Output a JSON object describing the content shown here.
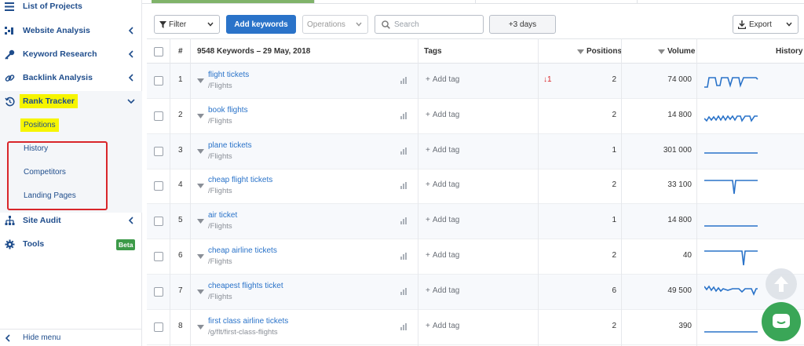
{
  "sidebar": {
    "items": [
      {
        "label": "List of Projects",
        "icon": "list-icon"
      },
      {
        "label": "Website Analysis",
        "icon": "analysis-icon"
      },
      {
        "label": "Keyword Research",
        "icon": "key-icon"
      },
      {
        "label": "Backlink Analysis",
        "icon": "link-icon"
      },
      {
        "label": "Rank Tracker",
        "icon": "history-icon"
      },
      {
        "label": "Site Audit",
        "icon": "sitemap-icon"
      },
      {
        "label": "Tools",
        "icon": "gear-icon"
      }
    ],
    "rank_tracker_sub": [
      "Positions",
      "History",
      "Competitors",
      "Landing Pages"
    ],
    "tools_badge": "Beta",
    "hide_menu": "Hide menu"
  },
  "toolbar": {
    "filter": "Filter",
    "add_keywords": "Add keywords",
    "operations": "Operations",
    "search_placeholder": "Search",
    "days": "+3 days",
    "export": "Export"
  },
  "table": {
    "headers": {
      "index": "#",
      "keywords": "9548 Keywords – 29 May, 2018",
      "tags": "Tags",
      "positions": "Positions",
      "volume": "Volume",
      "history": "History"
    },
    "add_tag": "Add tag",
    "rows": [
      {
        "n": "1",
        "kw": "flight tickets",
        "url": "/Flights",
        "delta": "1",
        "pos": "2",
        "vol": "74 000"
      },
      {
        "n": "2",
        "kw": "book flights",
        "url": "/Flights",
        "delta": "",
        "pos": "2",
        "vol": "14 800"
      },
      {
        "n": "3",
        "kw": "plane tickets",
        "url": "/Flights",
        "delta": "",
        "pos": "1",
        "vol": "301 000"
      },
      {
        "n": "4",
        "kw": "cheap flight tickets",
        "url": "/Flights",
        "delta": "",
        "pos": "2",
        "vol": "33 100"
      },
      {
        "n": "5",
        "kw": "air ticket",
        "url": "/Flights",
        "delta": "",
        "pos": "1",
        "vol": "14 800"
      },
      {
        "n": "6",
        "kw": "cheap airline tickets",
        "url": "/Flights",
        "delta": "",
        "pos": "2",
        "vol": "40"
      },
      {
        "n": "7",
        "kw": "cheapest flights ticket",
        "url": "/Flights",
        "delta": "",
        "pos": "6",
        "vol": "49 500"
      },
      {
        "n": "8",
        "kw": "first class airline tickets",
        "url": "/g/flt/first-class-flights",
        "delta": "",
        "pos": "2",
        "vol": "390"
      }
    ]
  },
  "colors": {
    "link": "#2a73c9",
    "nav": "#1f4d8c",
    "highlight": "#f6f500",
    "annotation": "#d9262a",
    "beta": "#3c9a48",
    "chat": "#3aa657"
  }
}
